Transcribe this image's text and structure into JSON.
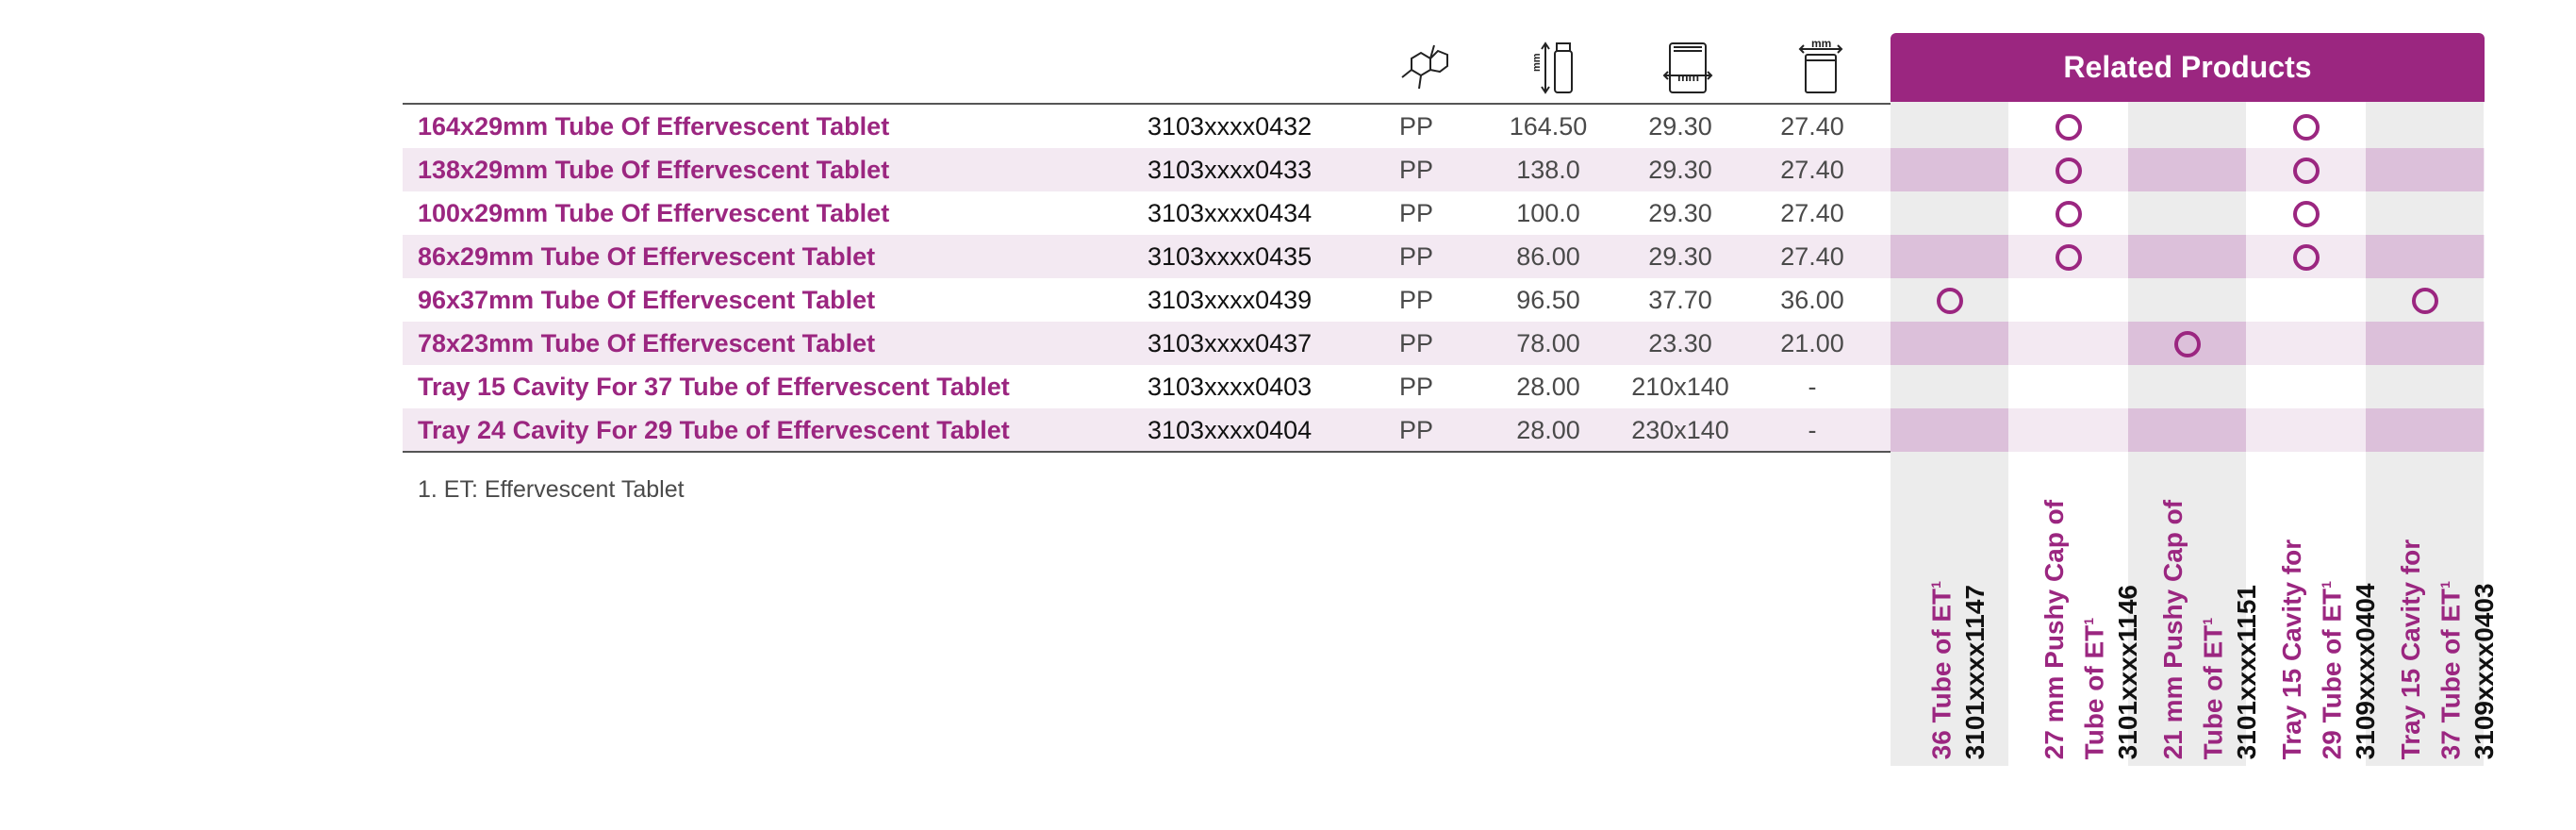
{
  "related_products": {
    "title": "Related Products",
    "columns": [
      {
        "name_line1": "36 Tube of ET",
        "name_line2": "",
        "sup": "1",
        "code": "3101xxxx1147"
      },
      {
        "name_line1": "27 mm Pushy Cap of",
        "name_line2": "Tube of ET",
        "sup": "1",
        "code": "3101xxxx1146"
      },
      {
        "name_line1": "21 mm Pushy Cap of",
        "name_line2": "Tube of ET",
        "sup": "1",
        "code": "3101xxxx1151"
      },
      {
        "name_line1": "Tray 15 Cavity for",
        "name_line2": "29 Tube of ET",
        "sup": "1",
        "code": "3109xxxx0404"
      },
      {
        "name_line1": "Tray 15 Cavity for",
        "name_line2": "37 Tube of ET",
        "sup": "1",
        "code": "3109xxxx0403"
      }
    ]
  },
  "header_icons": [
    "material-molecule-icon",
    "length-mm-icon",
    "diameter-mm-icon",
    "neck-mm-icon"
  ],
  "header_icon_text": {
    "mm": "mm"
  },
  "rows": [
    {
      "name": "164x29mm Tube Of Effervescent Tablet",
      "code": "3103xxxx0432",
      "material": "PP",
      "length": "164.50",
      "diameter": "29.30",
      "neck": "27.40",
      "compat": [
        false,
        true,
        false,
        true,
        false
      ]
    },
    {
      "name": "138x29mm Tube Of Effervescent Tablet",
      "code": "3103xxxx0433",
      "material": "PP",
      "length": "138.0",
      "diameter": "29.30",
      "neck": "27.40",
      "compat": [
        false,
        true,
        false,
        true,
        false
      ]
    },
    {
      "name": "100x29mm Tube Of Effervescent Tablet",
      "code": "3103xxxx0434",
      "material": "PP",
      "length": "100.0",
      "diameter": "29.30",
      "neck": "27.40",
      "compat": [
        false,
        true,
        false,
        true,
        false
      ]
    },
    {
      "name": "86x29mm Tube Of Effervescent Tablet",
      "code": "3103xxxx0435",
      "material": "PP",
      "length": "86.00",
      "diameter": "29.30",
      "neck": "27.40",
      "compat": [
        false,
        true,
        false,
        true,
        false
      ]
    },
    {
      "name": "96x37mm Tube Of Effervescent Tablet",
      "code": "3103xxxx0439",
      "material": "PP",
      "length": "96.50",
      "diameter": "37.70",
      "neck": "36.00",
      "compat": [
        true,
        false,
        false,
        false,
        true
      ]
    },
    {
      "name": "78x23mm Tube Of Effervescent Tablet",
      "code": "3103xxxx0437",
      "material": "PP",
      "length": "78.00",
      "diameter": "23.30",
      "neck": "21.00",
      "compat": [
        false,
        false,
        true,
        false,
        false
      ]
    },
    {
      "name": "Tray 15 Cavity For 37 Tube of Effervescent Tablet",
      "code": "3103xxxx0403",
      "material": "PP",
      "length": "28.00",
      "diameter": "210x140",
      "neck": "-",
      "compat": [
        false,
        false,
        false,
        false,
        false
      ]
    },
    {
      "name": "Tray 24 Cavity For 29 Tube of Effervescent Tablet",
      "code": "3103xxxx0404",
      "material": "PP",
      "length": "28.00",
      "diameter": "230x140",
      "neck": "-",
      "compat": [
        false,
        false,
        false,
        false,
        false
      ]
    }
  ],
  "footnote": "1. ET: Effervescent Tablet",
  "colors": {
    "brand": "#9b2680",
    "alt_row": "#f3e9f2",
    "alt_row_shade": "#dcc0da",
    "column_shade": "#ececec"
  }
}
